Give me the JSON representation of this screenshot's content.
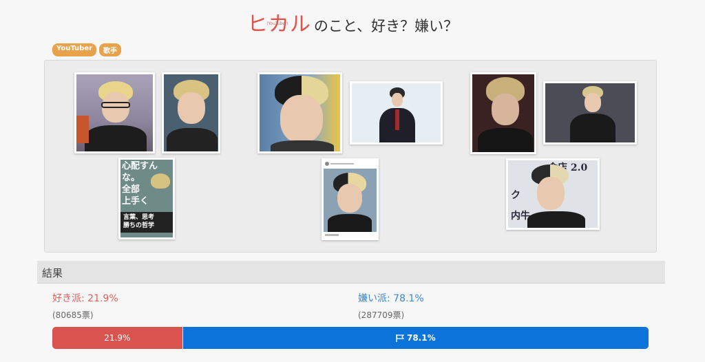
{
  "header": {
    "name": "ヒカル",
    "name_sub": "(YouTuber)",
    "question": "のこと、好き？嫌い？"
  },
  "tags": [
    "YouTuber",
    "歌手"
  ],
  "gallery": {
    "book_text_lines": [
      "心配すん",
      "な。",
      "全部",
      "上手く",
      "言葉、思考",
      "勝ちの哲学"
    ],
    "store_text": [
      "食店 2.0",
      "ク",
      "内牛"
    ]
  },
  "results": {
    "heading": "結果",
    "like": {
      "label": "好き派: 21.9%",
      "votes": "(80685票)",
      "bar_label": "21.9%",
      "fraction": 0.219,
      "color": "#d9534f"
    },
    "dislike": {
      "label": "嫌い派: 78.1%",
      "votes": "(287709票)",
      "bar_label": "78.1%",
      "fraction": 0.781,
      "color": "#0b73d9"
    },
    "flag_icon": "flag-icon"
  }
}
